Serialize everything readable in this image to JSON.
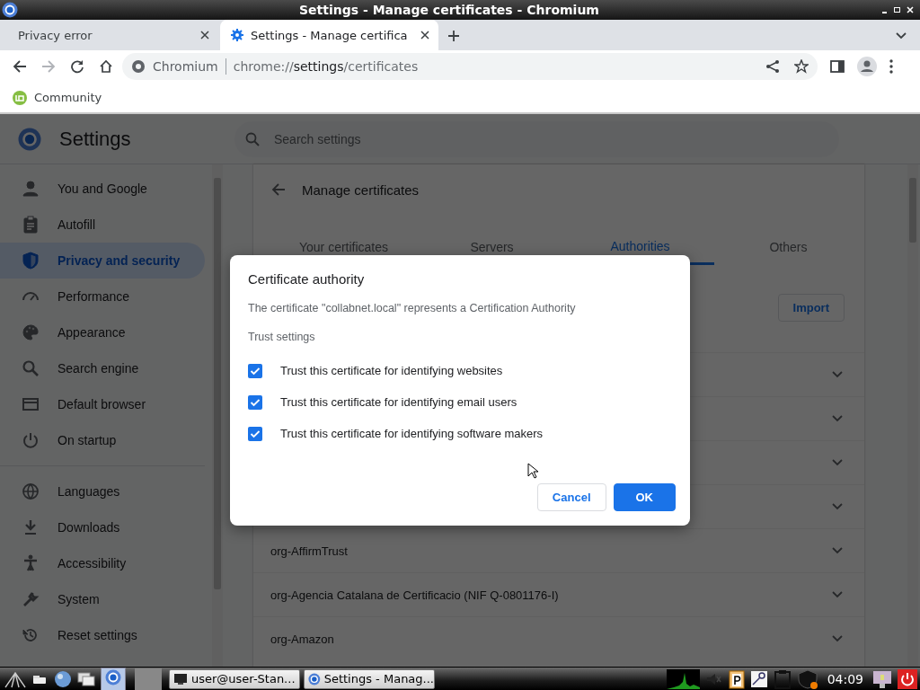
{
  "window": {
    "title": "Settings - Manage certificates - Chromium"
  },
  "browser_tabs": [
    {
      "title": "Privacy error",
      "selected": false
    },
    {
      "title": "Settings - Manage certifica",
      "selected": true
    }
  ],
  "toolbar": {
    "back_disabled": false,
    "forward_disabled": true,
    "site_label": "Chromium",
    "url": [
      "chrome://",
      "settings",
      "/certificates"
    ]
  },
  "bookmarks": [
    {
      "label": "Community"
    }
  ],
  "settings": {
    "title": "Settings",
    "search": {
      "placeholder": "Search settings"
    },
    "sidebar": {
      "groups": [
        [
          {
            "label": "You and Google",
            "selected": false
          },
          {
            "label": "Autofill",
            "selected": false
          },
          {
            "label": "Privacy and security",
            "selected": true
          },
          {
            "label": "Performance",
            "selected": false
          },
          {
            "label": "Appearance",
            "selected": false
          },
          {
            "label": "Search engine",
            "selected": false
          },
          {
            "label": "Default browser",
            "selected": false
          },
          {
            "label": "On startup",
            "selected": false
          }
        ],
        [
          {
            "label": "Languages",
            "selected": false
          },
          {
            "label": "Downloads",
            "selected": false
          },
          {
            "label": "Accessibility",
            "selected": false
          },
          {
            "label": "System",
            "selected": false
          },
          {
            "label": "Reset settings",
            "selected": false
          }
        ]
      ]
    }
  },
  "page": {
    "title": "Manage certificates",
    "tabs": [
      {
        "label": "Your certificates",
        "selected": false
      },
      {
        "label": "Servers",
        "selected": false
      },
      {
        "label": "Authorities",
        "selected": true
      },
      {
        "label": "Others",
        "selected": false
      }
    ],
    "import_button": "Import",
    "certificates": [
      {
        "expanded": false
      },
      {
        "expanded": false
      },
      {
        "expanded": false
      },
      {
        "expanded": false
      },
      {
        "label": "org-AffirmTrust",
        "expanded": false
      },
      {
        "label": "org-Agencia Catalana de Certificacio (NIF Q-0801176-I)",
        "expanded": false
      },
      {
        "label": "org-Amazon",
        "expanded": false
      }
    ]
  },
  "dialog": {
    "title": "Certificate authority",
    "description": "The certificate \"collabnet.local\" represents a Certification Authority",
    "section": "Trust settings",
    "checkboxes": [
      {
        "label": "Trust this certificate for identifying websites",
        "checked": true
      },
      {
        "label": "Trust this certificate for identifying email users",
        "checked": true
      },
      {
        "label": "Trust this certificate for identifying software makers",
        "checked": true
      }
    ],
    "buttons": [
      {
        "label": "Cancel",
        "kind": "secondary"
      },
      {
        "label": "OK",
        "kind": "primary"
      }
    ]
  },
  "taskbar": {
    "windows": [
      {
        "label": "user@user-Stan...",
        "kind": "terminal"
      },
      {
        "label": "Settings - Manag...",
        "kind": "browser"
      }
    ],
    "clock": "04:09"
  }
}
